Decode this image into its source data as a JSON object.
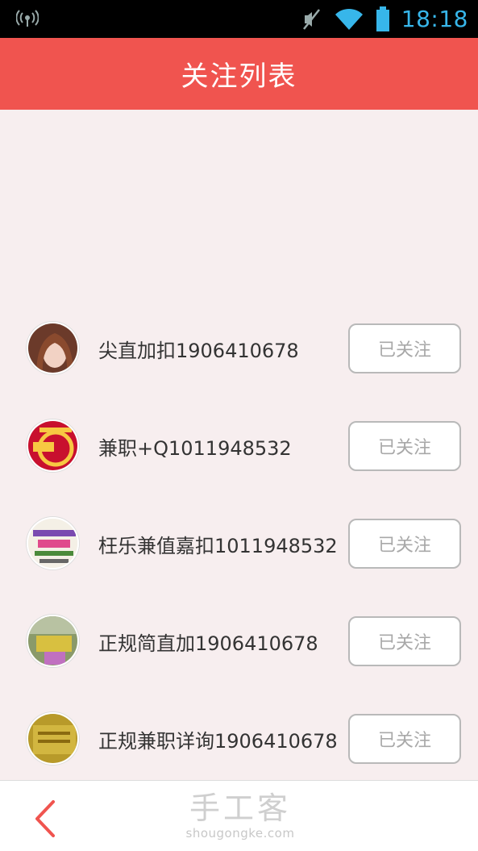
{
  "status_bar": {
    "time": "18:18",
    "icons": [
      "signal-broadcast-icon",
      "mute-icon",
      "wifi-icon",
      "battery-icon"
    ]
  },
  "header": {
    "title": "关注列表",
    "color": "#f0544f"
  },
  "follow_list": [
    {
      "name": "尖直加扣1906410678",
      "button": "已关注",
      "avatar": "avatar-girl"
    },
    {
      "name": "兼职+Q1011948532",
      "button": "已关注",
      "avatar": "avatar-recruit-red"
    },
    {
      "name": "枉乐兼值嘉扣1011948532",
      "button": "已关注",
      "avatar": "avatar-qr-ad"
    },
    {
      "name": "正规简直加1906410678",
      "button": "已关注",
      "avatar": "avatar-photo"
    },
    {
      "name": "正规兼职详询1906410678",
      "button": "已关注",
      "avatar": "avatar-gold"
    }
  ],
  "bottom_bar": {
    "back_icon": "chevron-left-icon",
    "watermark_cn": "手工客",
    "watermark_en": "shougongke.com"
  }
}
